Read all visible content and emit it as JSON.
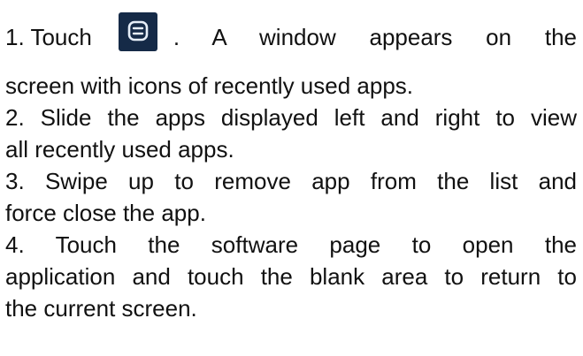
{
  "steps": [
    {
      "lines": [
        {
          "pre": "1. Touch",
          "post": ". A window appears on the"
        },
        "screen with icons of recently used apps."
      ]
    },
    {
      "lines": [
        "2. Slide the apps displayed left and right to view",
        "all recently used apps."
      ]
    },
    {
      "lines": [
        "3. Swipe up to remove app from the list and",
        "force close the app."
      ]
    },
    {
      "lines": [
        "4. Touch the software page to open the",
        "application and touch the blank area to return to",
        "the current screen."
      ]
    }
  ],
  "icon": {
    "name": "recent-apps-icon",
    "background": "#152a47",
    "stroke": "#e6eef8"
  }
}
